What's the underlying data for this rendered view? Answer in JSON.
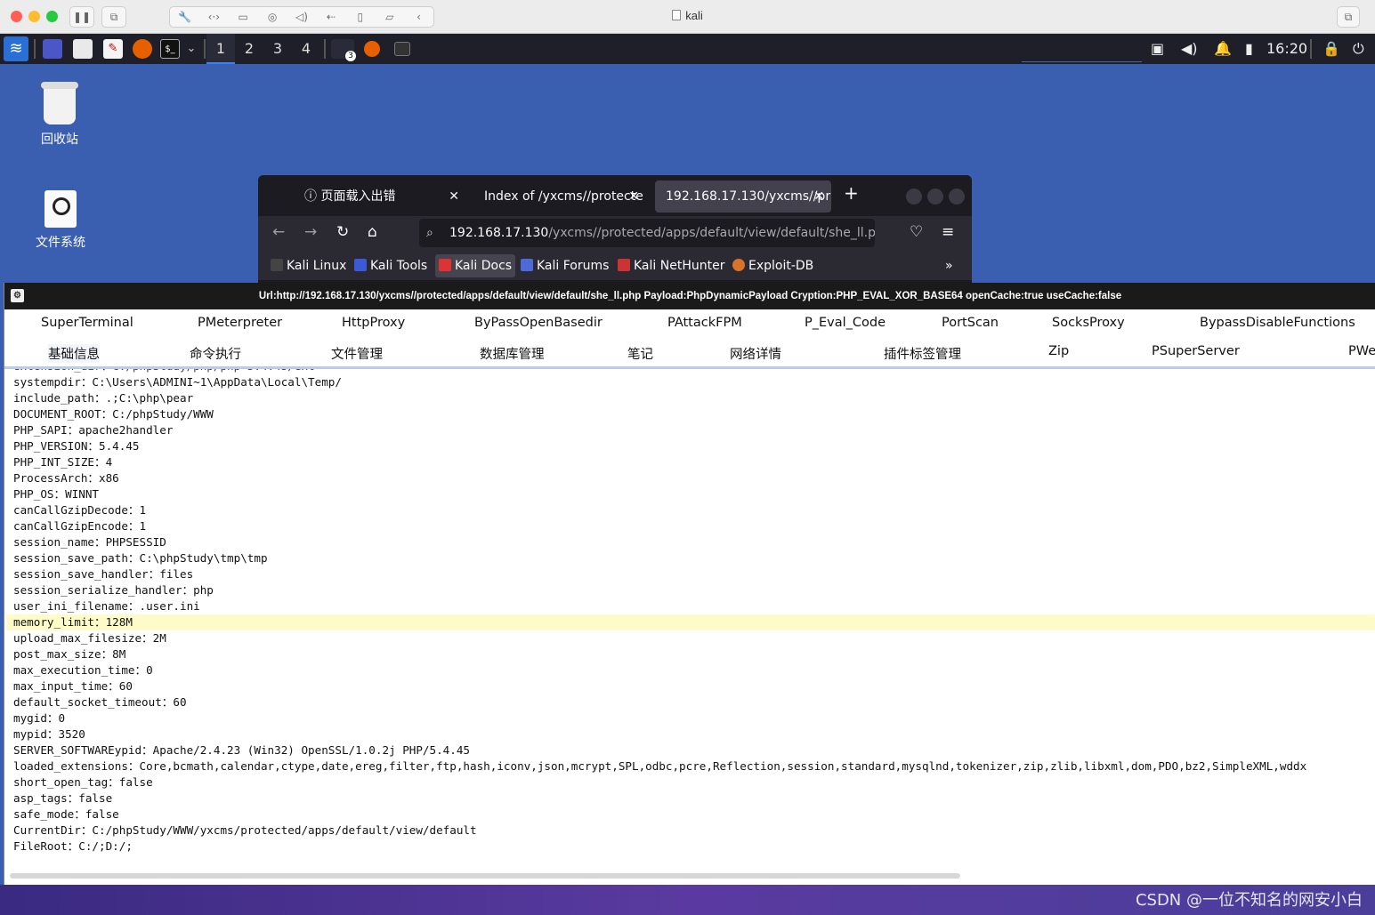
{
  "host": {
    "title": "kali"
  },
  "panel": {
    "workspaces": [
      "1",
      "2",
      "3",
      "4"
    ],
    "active_workspace": 0,
    "badge": "3",
    "clock": "16:20"
  },
  "desktop": {
    "icons": [
      {
        "label": "回收站",
        "icon": "trash-icon"
      },
      {
        "label": "文件系统",
        "icon": "drive-icon"
      }
    ]
  },
  "firefox": {
    "tabs": [
      {
        "label": "页面载入出错",
        "icon": "info-icon"
      },
      {
        "label": "Index of /yxcms//protecte"
      },
      {
        "label": "192.168.17.130/yxcms//pr"
      }
    ],
    "url_host": "192.168.17.130",
    "url_rest": "/yxcms//protected/apps/default/view/default/she_ll.ph",
    "bookmarks": [
      "Kali Linux",
      "Kali Tools",
      "Kali Docs",
      "Kali Forums",
      "Kali NetHunter",
      "Exploit-DB"
    ],
    "selected_bookmark": 2
  },
  "godzilla": {
    "title": "Url:http://192.168.17.130/yxcms//protected/apps/default/view/default/she_ll.php Payload:PhpDynamicPayload Cryption:PHP_EVAL_XOR_BASE64 openCache:true useCache:false",
    "tabs_row1": [
      "SuperTerminal",
      "PMeterpreter",
      "HttpProxy",
      "ByPassOpenBasedir",
      "PAttackFPM",
      "P_Eval_Code",
      "PortScan",
      "SocksProxy",
      "BypassDisableFunctions"
    ],
    "tabs_row2": [
      "基础信息",
      "命令执行",
      "文件管理",
      "数据库管理",
      "笔记",
      "网络详情",
      "插件标签管理",
      "Zip",
      "PSuperServer",
      "PWe"
    ],
    "selected_tab": "基础信息",
    "highlight_line": 15,
    "lines": [
      "systempdir：C:\\Users\\ADMINI~1\\AppData\\Local\\Temp/",
      "include_path：.;C:\\php\\pear",
      "DOCUMENT_ROOT：C:/phpStudy/WWW",
      "PHP_SAPI：apache2handler",
      "PHP_VERSION：5.4.45",
      "PHP_INT_SIZE：4",
      "ProcessArch：x86",
      "PHP_OS：WINNT",
      "canCallGzipDecode：1",
      "canCallGzipEncode：1",
      "session_name：PHPSESSID",
      "session_save_path：C:\\phpStudy\\tmp\\tmp",
      "session_save_handler：files",
      "session_serialize_handler：php",
      "user_ini_filename：.user.ini",
      "memory_limit：128M",
      "upload_max_filesize：2M",
      "post_max_size：8M",
      "max_execution_time：0",
      "max_input_time：60",
      "default_socket_timeout：60",
      "mygid：0",
      "mypid：3520",
      "SERVER_SOFTWAREypid：Apache/2.4.23 (Win32) OpenSSL/1.0.2j PHP/5.4.45",
      "loaded_extensions：Core,bcmath,calendar,ctype,date,ereg,filter,ftp,hash,iconv,json,mcrypt,SPL,odbc,pcre,Reflection,session,standard,mysqlnd,tokenizer,zip,zlib,libxml,dom,PDO,bz2,SimpleXML,wddx",
      "short_open_tag：false",
      "asp_tags：false",
      "safe_mode：false",
      "CurrentDir：C:/phpStudy/WWW/yxcms/protected/apps/default/view/default",
      "FileRoot：C:/;D:/;"
    ]
  },
  "watermark": "CSDN @一位不知名的网安小白",
  "colors": {
    "kali_panel": "#1e1f29",
    "desktop": "#3a5fb0",
    "highlight": "#fdfcc8"
  }
}
